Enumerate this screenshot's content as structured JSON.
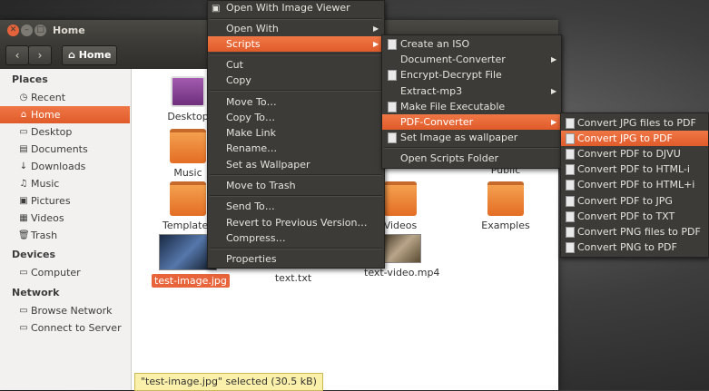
{
  "window": {
    "title": "Home",
    "path_label": "Home"
  },
  "sidebar": {
    "places_label": "Places",
    "places": [
      {
        "label": "Recent",
        "icon": "clock-icon"
      },
      {
        "label": "Home",
        "icon": "home-icon",
        "active": true
      },
      {
        "label": "Desktop",
        "icon": "desktop-icon"
      },
      {
        "label": "Documents",
        "icon": "documents-icon"
      },
      {
        "label": "Downloads",
        "icon": "download-icon"
      },
      {
        "label": "Music",
        "icon": "music-icon"
      },
      {
        "label": "Pictures",
        "icon": "pictures-icon"
      },
      {
        "label": "Videos",
        "icon": "videos-icon"
      },
      {
        "label": "Trash",
        "icon": "trash-icon"
      }
    ],
    "devices_label": "Devices",
    "devices": [
      {
        "label": "Computer",
        "icon": "computer-icon"
      }
    ],
    "network_label": "Network",
    "network": [
      {
        "label": "Browse Network",
        "icon": "network-icon"
      },
      {
        "label": "Connect to Server",
        "icon": "server-icon"
      }
    ]
  },
  "files": [
    {
      "label": "Desktop"
    },
    {
      "label": "Music"
    },
    {
      "label": "Templates"
    },
    {
      "label": "test-image.jpg",
      "selected": true
    },
    {
      "label": "text.txt"
    },
    {
      "label": "text-video.mp4"
    },
    {
      "label": "Public"
    },
    {
      "label": "Videos"
    },
    {
      "label": "Examples"
    }
  ],
  "status": "\"test-image.jpg\" selected  (30.5 kB)",
  "context_menu": {
    "items": [
      "Open With Image Viewer",
      "Open With",
      "Scripts",
      "Cut",
      "Copy",
      "Move To…",
      "Copy To…",
      "Make Link",
      "Rename…",
      "Set as Wallpaper",
      "Move to Trash",
      "Send To…",
      "Revert to Previous Version…",
      "Compress…",
      "Properties"
    ]
  },
  "scripts_menu": {
    "items": [
      "Create an ISO",
      "Document-Converter",
      "Encrypt-Decrypt File",
      "Extract-mp3",
      "Make File Executable",
      "PDF-Converter",
      "Set Image as wallpaper",
      "Open Scripts Folder"
    ]
  },
  "pdf_menu": {
    "items": [
      "Convert JPG files to PDF",
      "Convert JPG to PDF",
      "Convert PDF to DJVU",
      "Convert PDF to HTML-i",
      "Convert PDF to HTML+i",
      "Convert PDF to JPG",
      "Convert PDF to TXT",
      "Convert PNG files to PDF",
      "Convert PNG to PDF"
    ]
  },
  "colors": {
    "accent": "#e8643a",
    "menu_bg": "#3c3b37",
    "titlebar": "#3c3b37",
    "status_bg": "#fbf0a9"
  }
}
